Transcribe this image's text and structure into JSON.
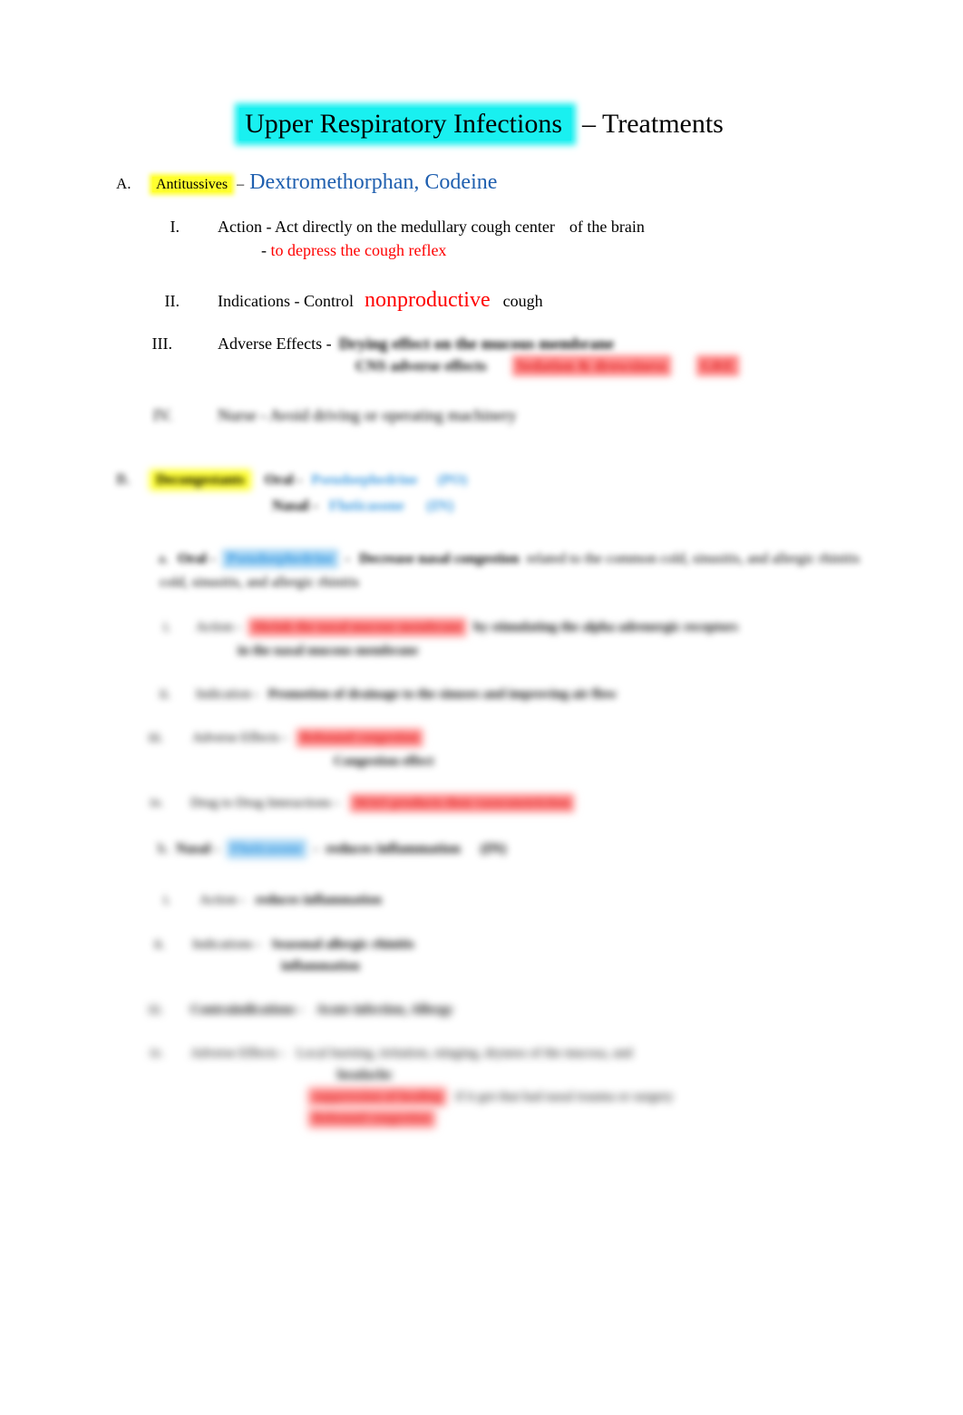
{
  "document": {
    "title_highlighted": "Upper Respiratory Infections",
    "title_tail": "– Treatments"
  },
  "sections": [
    {
      "marker": "A.",
      "label": "Antitussives",
      "dash": "–",
      "drugs": "Dextromethorphan, Codeine",
      "items": [
        {
          "marker": "I.",
          "text": "Action - Act directly on the  medullary cough center",
          "tail": "of the brain",
          "sub_dash": "-",
          "sub_red": "to depress the cough reflex"
        },
        {
          "marker": "II.",
          "text": "Indications - Control",
          "emphasis": "nonproductive",
          "tail": "cough"
        },
        {
          "marker": "III.",
          "text": "Adverse Effects -",
          "blurred_a": "Drying effect on the mucous membrane",
          "blurred_b": "CNS adverse effects",
          "blurred_red_a": "Sedation & drowsiness",
          "blurred_red_b": "GRE"
        },
        {
          "marker": "IV.",
          "text": "Nurse - Avoid driving or operating machinery"
        }
      ]
    },
    {
      "marker": "B.",
      "label": "Decongestants",
      "oral_label": "Oral -",
      "oral_drug": "Pseudoephedrine",
      "oral_route": "(PO)",
      "nasal_label": "Nasal -",
      "nasal_drug": "Fluticasone",
      "nasal_route": "(IN)",
      "items": [
        {
          "marker": "a.",
          "route": "Oral -",
          "drug": "Pseudoephedrine",
          "dash": "-",
          "bold_text": "Decrease nasal congestion",
          "tail": "related to the common cold, sinusitis, and allergic rhinitis",
          "subitems": [
            {
              "marker": "i.",
              "label": "Action -",
              "red_text": "Shrink the nasal mucous membrane",
              "text": "by stimulating the alpha adrenergic receptors",
              "tail": "in the nasal mucous membrane"
            },
            {
              "marker": "ii.",
              "label": "Indication -",
              "bold_text": "Promotion of drainage to the sinuses and improving air flow"
            },
            {
              "marker": "iii.",
              "label": "Adverse Effects -",
              "red_text": "Rebound congestion",
              "sub_text": "Congestion effect"
            },
            {
              "marker": "iv.",
              "label": "Drug to Drug Interactions -",
              "red_text": "MAO products then vasoconstriction"
            }
          ]
        },
        {
          "marker": "b.",
          "route": "Nasal -",
          "drug": "Fluticasone",
          "dash": "-",
          "bold_text": "reduces inflammation",
          "route_tag": "(IN)",
          "subitems": [
            {
              "marker": "i.",
              "label": "Action -",
              "bold_text": "reduces inflammation"
            },
            {
              "marker": "ii.",
              "label": "Indications -",
              "bold_text": "Seasonal allergic rhinitis",
              "sub_text": "inflammation"
            },
            {
              "marker": "iii.",
              "label": "Contraindications -",
              "bold_text": "Acute infection, Allergy"
            },
            {
              "marker": "iv.",
              "label": "Adverse Effects -",
              "text": "Local burning, irritation, stinging, dryness of the mucosa, and",
              "sub_text": "headache",
              "red_text": "suppression of healing",
              "tail": "if it got that had nasal trauma or surgery",
              "red_text_b": "Rebound congestion"
            }
          ]
        }
      ]
    }
  ],
  "colors": {
    "cyan_highlight": "#19F0F0",
    "yellow_highlight": "#FFFF2E",
    "red_highlight": "#FF8A8A",
    "blue_highlight": "#A8D6F5",
    "blue_text": "#1F5FAF",
    "light_blue_text": "#3D9BE0",
    "red_text": "#FF0000"
  }
}
